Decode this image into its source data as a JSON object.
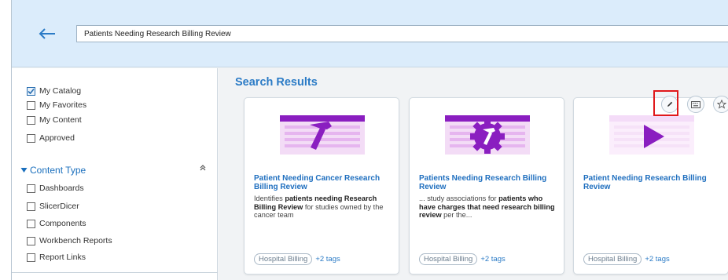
{
  "header": {
    "back_icon": "left-arrow-icon",
    "search_value": "Patients Needing Research Billing Review"
  },
  "sidebar": {
    "catalog_filters": [
      {
        "label": "My Catalog",
        "checked": true
      },
      {
        "label": "My Favorites",
        "checked": false
      },
      {
        "label": "My Content",
        "checked": false
      },
      {
        "label": "Approved",
        "checked": false
      }
    ],
    "content_type": {
      "label": "Content Type",
      "items": [
        {
          "label": "Dashboards",
          "checked": false
        },
        {
          "label": "SlicerDicer",
          "checked": false
        },
        {
          "label": "Components",
          "checked": false
        },
        {
          "label": "Workbench Reports",
          "checked": false
        },
        {
          "label": "Report Links",
          "checked": false
        }
      ]
    }
  },
  "main": {
    "title": "Search Results",
    "cards": [
      {
        "title": "Patient Needing Cancer Research Billing Review",
        "desc": [
          {
            "t": "Identifies ",
            "b": false
          },
          {
            "t": "patients needing Research Billing Review",
            "b": true
          },
          {
            "t": " for studies owned by the cancer team",
            "b": false
          }
        ],
        "tag": "Hospital Billing",
        "more_tags": "+2 tags",
        "icon": "hammer-icon"
      },
      {
        "title": "Patients Needing Research Billing Review",
        "desc": [
          {
            "t": "... study associations for ",
            "b": false
          },
          {
            "t": "patients who have charges that need research billing review",
            "b": true
          },
          {
            "t": " per the...",
            "b": false
          }
        ],
        "tag": "Hospital Billing",
        "more_tags": "+2 tags",
        "icon": "gear-hammer-icon"
      },
      {
        "title": "Patient Needing Research Billing Review",
        "desc": [],
        "tag": "Hospital Billing",
        "more_tags": "+2 tags",
        "icon": "play-icon"
      }
    ],
    "card_actions": [
      "edit-pencil-icon",
      "keyboard-icon",
      "star-icon"
    ]
  },
  "colors": {
    "accent": "#2b7bc6",
    "thumb": "#8a1ec0",
    "highlight": "#e0191b",
    "header_bg": "#dbecfb"
  }
}
